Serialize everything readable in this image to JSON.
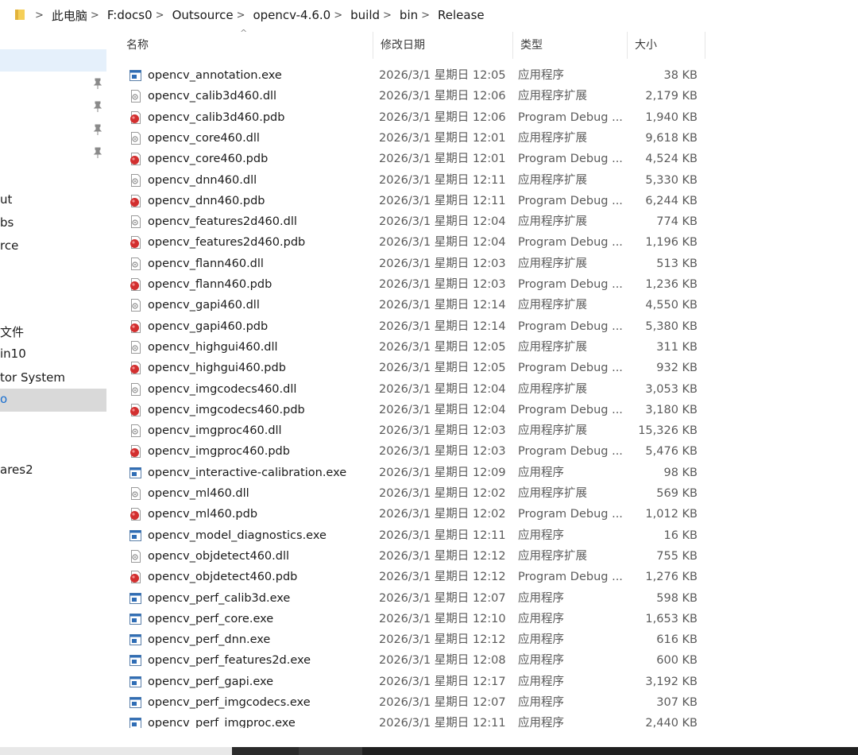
{
  "address": {
    "crumbs": [
      "此电脑",
      "F:docs0",
      "Outsource",
      "opencv-4.6.0",
      "build",
      "bin",
      "Release"
    ]
  },
  "nav": {
    "items": [
      "ut",
      "bs",
      "rce",
      "文件",
      "in10",
      "tor System",
      "o",
      "ares2"
    ]
  },
  "columns": {
    "name": "名称",
    "date": "修改日期",
    "type": "类型",
    "size": "大小"
  },
  "files": [
    {
      "name": "opencv_annotation.exe",
      "date": "2026/3/1 星期日 12:05",
      "type": "应用程序",
      "size": "38 KB",
      "icon": "exe-icon"
    },
    {
      "name": "opencv_calib3d460.dll",
      "date": "2026/3/1 星期日 12:06",
      "type": "应用程序扩展",
      "size": "2,179 KB",
      "icon": "dll-icon"
    },
    {
      "name": "opencv_calib3d460.pdb",
      "date": "2026/3/1 星期日 12:06",
      "type": "Program Debug ...",
      "size": "1,940 KB",
      "icon": "pdb-icon"
    },
    {
      "name": "opencv_core460.dll",
      "date": "2026/3/1 星期日 12:01",
      "type": "应用程序扩展",
      "size": "9,618 KB",
      "icon": "dll-icon"
    },
    {
      "name": "opencv_core460.pdb",
      "date": "2026/3/1 星期日 12:01",
      "type": "Program Debug ...",
      "size": "4,524 KB",
      "icon": "pdb-icon"
    },
    {
      "name": "opencv_dnn460.dll",
      "date": "2026/3/1 星期日 12:11",
      "type": "应用程序扩展",
      "size": "5,330 KB",
      "icon": "dll-icon"
    },
    {
      "name": "opencv_dnn460.pdb",
      "date": "2026/3/1 星期日 12:11",
      "type": "Program Debug ...",
      "size": "6,244 KB",
      "icon": "pdb-icon"
    },
    {
      "name": "opencv_features2d460.dll",
      "date": "2026/3/1 星期日 12:04",
      "type": "应用程序扩展",
      "size": "774 KB",
      "icon": "dll-icon"
    },
    {
      "name": "opencv_features2d460.pdb",
      "date": "2026/3/1 星期日 12:04",
      "type": "Program Debug ...",
      "size": "1,196 KB",
      "icon": "pdb-icon"
    },
    {
      "name": "opencv_flann460.dll",
      "date": "2026/3/1 星期日 12:03",
      "type": "应用程序扩展",
      "size": "513 KB",
      "icon": "dll-icon"
    },
    {
      "name": "opencv_flann460.pdb",
      "date": "2026/3/1 星期日 12:03",
      "type": "Program Debug ...",
      "size": "1,236 KB",
      "icon": "pdb-icon"
    },
    {
      "name": "opencv_gapi460.dll",
      "date": "2026/3/1 星期日 12:14",
      "type": "应用程序扩展",
      "size": "4,550 KB",
      "icon": "dll-icon"
    },
    {
      "name": "opencv_gapi460.pdb",
      "date": "2026/3/1 星期日 12:14",
      "type": "Program Debug ...",
      "size": "5,380 KB",
      "icon": "pdb-icon"
    },
    {
      "name": "opencv_highgui460.dll",
      "date": "2026/3/1 星期日 12:05",
      "type": "应用程序扩展",
      "size": "311 KB",
      "icon": "dll-icon"
    },
    {
      "name": "opencv_highgui460.pdb",
      "date": "2026/3/1 星期日 12:05",
      "type": "Program Debug ...",
      "size": "932 KB",
      "icon": "pdb-icon"
    },
    {
      "name": "opencv_imgcodecs460.dll",
      "date": "2026/3/1 星期日 12:04",
      "type": "应用程序扩展",
      "size": "3,053 KB",
      "icon": "dll-icon"
    },
    {
      "name": "opencv_imgcodecs460.pdb",
      "date": "2026/3/1 星期日 12:04",
      "type": "Program Debug ...",
      "size": "3,180 KB",
      "icon": "pdb-icon"
    },
    {
      "name": "opencv_imgproc460.dll",
      "date": "2026/3/1 星期日 12:03",
      "type": "应用程序扩展",
      "size": "15,326 KB",
      "icon": "dll-icon"
    },
    {
      "name": "opencv_imgproc460.pdb",
      "date": "2026/3/1 星期日 12:03",
      "type": "Program Debug ...",
      "size": "5,476 KB",
      "icon": "pdb-icon"
    },
    {
      "name": "opencv_interactive-calibration.exe",
      "date": "2026/3/1 星期日 12:09",
      "type": "应用程序",
      "size": "98 KB",
      "icon": "exe-icon"
    },
    {
      "name": "opencv_ml460.dll",
      "date": "2026/3/1 星期日 12:02",
      "type": "应用程序扩展",
      "size": "569 KB",
      "icon": "dll-icon"
    },
    {
      "name": "opencv_ml460.pdb",
      "date": "2026/3/1 星期日 12:02",
      "type": "Program Debug ...",
      "size": "1,012 KB",
      "icon": "pdb-icon"
    },
    {
      "name": "opencv_model_diagnostics.exe",
      "date": "2026/3/1 星期日 12:11",
      "type": "应用程序",
      "size": "16 KB",
      "icon": "exe-icon"
    },
    {
      "name": "opencv_objdetect460.dll",
      "date": "2026/3/1 星期日 12:12",
      "type": "应用程序扩展",
      "size": "755 KB",
      "icon": "dll-icon"
    },
    {
      "name": "opencv_objdetect460.pdb",
      "date": "2026/3/1 星期日 12:12",
      "type": "Program Debug ...",
      "size": "1,276 KB",
      "icon": "pdb-icon"
    },
    {
      "name": "opencv_perf_calib3d.exe",
      "date": "2026/3/1 星期日 12:07",
      "type": "应用程序",
      "size": "598 KB",
      "icon": "exe-icon"
    },
    {
      "name": "opencv_perf_core.exe",
      "date": "2026/3/1 星期日 12:10",
      "type": "应用程序",
      "size": "1,653 KB",
      "icon": "exe-icon"
    },
    {
      "name": "opencv_perf_dnn.exe",
      "date": "2026/3/1 星期日 12:12",
      "type": "应用程序",
      "size": "616 KB",
      "icon": "exe-icon"
    },
    {
      "name": "opencv_perf_features2d.exe",
      "date": "2026/3/1 星期日 12:08",
      "type": "应用程序",
      "size": "600 KB",
      "icon": "exe-icon"
    },
    {
      "name": "opencv_perf_gapi.exe",
      "date": "2026/3/1 星期日 12:17",
      "type": "应用程序",
      "size": "3,192 KB",
      "icon": "exe-icon"
    },
    {
      "name": "opencv_perf_imgcodecs.exe",
      "date": "2026/3/1 星期日 12:07",
      "type": "应用程序",
      "size": "307 KB",
      "icon": "exe-icon"
    },
    {
      "name": "opencv_perf_imgproc.exe",
      "date": "2026/3/1 星期日 12:11",
      "type": "应用程序",
      "size": "2,440 KB",
      "icon": "exe-icon"
    }
  ]
}
